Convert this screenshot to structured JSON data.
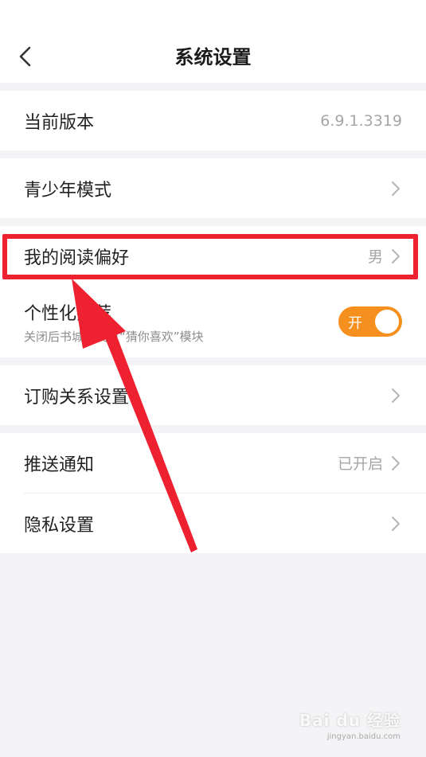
{
  "header": {
    "title": "系统设置",
    "back_icon": "chevron-left-icon"
  },
  "rows": {
    "version": {
      "label": "当前版本",
      "value": "6.9.1.3319"
    },
    "youth_mode": {
      "label": "青少年模式"
    },
    "reading_pref": {
      "label": "我的阅读偏好",
      "value": "男"
    },
    "personal_rec": {
      "label": "个性化推荐",
      "sub": "关闭后书城将没有“猜你喜欢”模块",
      "toggle_label": "开",
      "toggle_state": "on"
    },
    "subscription": {
      "label": "订购关系设置"
    },
    "push": {
      "label": "推送通知",
      "value": "已开启"
    },
    "privacy": {
      "label": "隐私设置"
    }
  },
  "colors": {
    "accent": "#f5901e",
    "highlight": "#ee2130",
    "background": "#f4f4f6"
  },
  "watermark": {
    "text": "Bai du 经验",
    "sub": "jingyan.baidu.com"
  }
}
